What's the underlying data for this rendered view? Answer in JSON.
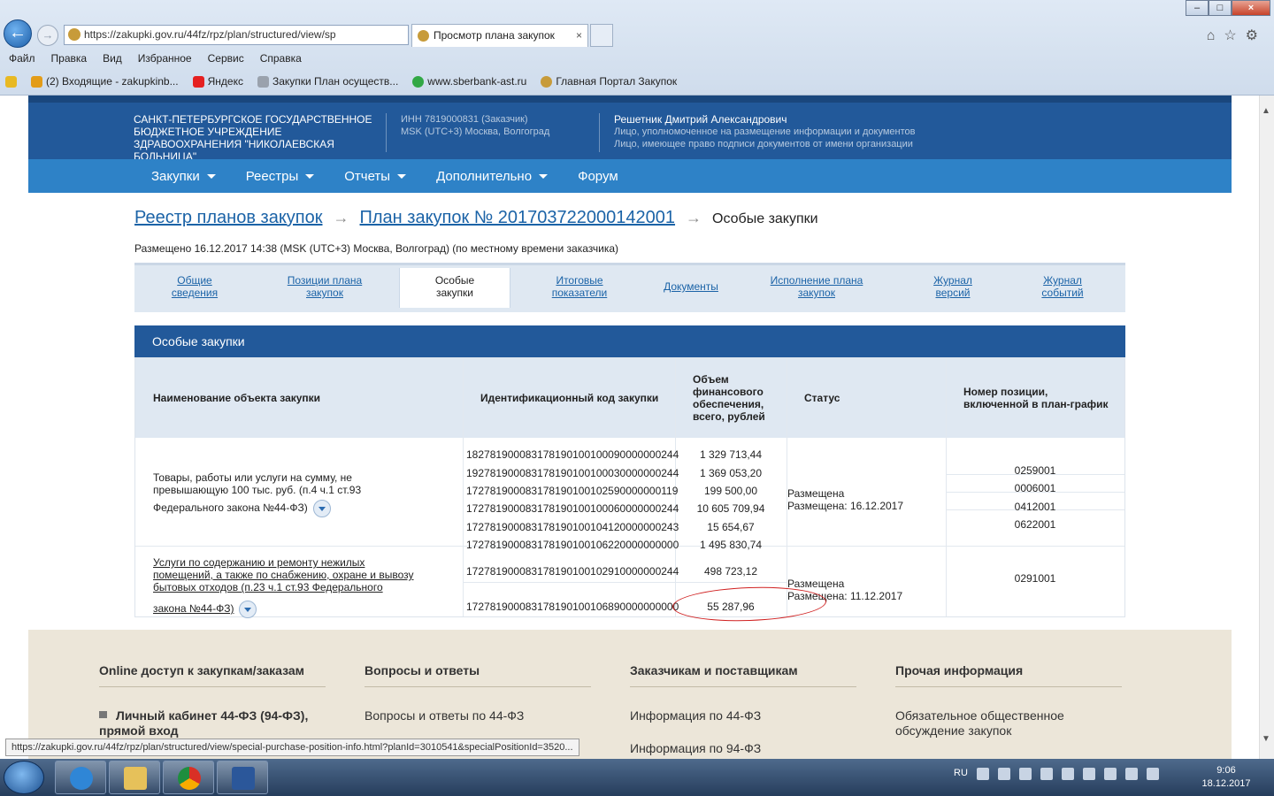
{
  "browser": {
    "url": "https://zakupki.gov.ru/44fz/rpz/plan/structured/view/sp",
    "tab_title": "Просмотр плана закупок",
    "menu": [
      "Файл",
      "Правка",
      "Вид",
      "Избранное",
      "Сервис",
      "Справка"
    ],
    "favorites": [
      "(2) Входящие - zakupkinb...",
      "Яндекс",
      "Закупки План осуществ...",
      "www.sberbank-ast.ru",
      "Главная Портал Закупок"
    ],
    "status_url": "https://zakupki.gov.ru/44fz/rpz/plan/structured/view/special-purchase-position-info.html?planId=3010541&specialPositionId=3520..."
  },
  "header": {
    "org_name": "САНКТ-ПЕТЕРБУРГСКОЕ ГОСУДАРСТВЕННОЕ БЮДЖЕТНОЕ УЧРЕЖДЕНИЕ ЗДРАВООХРАНЕНИЯ \"НИКОЛАЕВСКАЯ БОЛЬНИЦА\"",
    "inn": "ИНН 7819000831 (Заказчик)",
    "timezone": "MSK (UTC+3) Москва, Волгоград",
    "user_name": "Решетник Дмитрий Александрович",
    "user_role1": "Лицо, уполномоченное на размещение информации и документов",
    "user_role2": "Лицо, имеющее право подписи документов от имени организации"
  },
  "nav": [
    "Закупки",
    "Реестры",
    "Отчеты",
    "Дополнительно",
    "Форум"
  ],
  "breadcrumb": {
    "item1": "Реестр планов закупок",
    "item2": "План закупок № 201703722000142001",
    "current": "Особые закупки"
  },
  "posted": "Размещено 16.12.2017 14:38 (MSK (UTC+3) Москва, Волгоград) (по местному времени заказчика)",
  "tabs": [
    {
      "l1": "Общие",
      "l2": "сведения"
    },
    {
      "l1": "Позиции плана",
      "l2": "закупок"
    },
    {
      "l1": "Особые",
      "l2": "закупки"
    },
    {
      "l1": "Итоговые",
      "l2": "показатели"
    },
    {
      "l1": "Документы",
      "l2": ""
    },
    {
      "l1": "Исполнение плана",
      "l2": "закупок"
    },
    {
      "l1": "Журнал",
      "l2": "версий"
    },
    {
      "l1": "Журнал",
      "l2": "событий"
    }
  ],
  "panel_title": "Особые закупки",
  "table": {
    "headers": [
      "Наименование объекта закупки",
      "Идентификационный код закупки",
      "Объем финансового обеспечения, всего, рублей",
      "Статус",
      "Номер позиции, включенной в план-график"
    ],
    "group1": {
      "name1": "Товары, работы или услуги на сумму, не превышающую 100 тыс. руб. (п.4 ч.1 ст.93",
      "name2": "Федерального закона №44-ФЗ)",
      "codes": [
        "182781900083178190100100090000000244",
        "192781900083178190100100030000000244",
        "172781900083178190100102590000000119",
        "172781900083178190100100060000000244",
        "172781900083178190100104120000000243",
        "172781900083178190100106220000000000"
      ],
      "amounts": [
        "1 329 713,44",
        "1 369 053,20",
        "199 500,00",
        "10 605 709,94",
        "15 654,67",
        "1 495 830,74"
      ],
      "status": "Размещена",
      "status_date": "Размещена: 16.12.2017",
      "positions": [
        "0259001",
        "0006001",
        "0412001",
        "0622001"
      ]
    },
    "group2": {
      "name1": "Услуги по содержанию и ремонту нежилых помещений, а также по снабжению, охране и вывозу бытовых отходов (п.23 ч.1 ст.93 Федерального",
      "name2": "закона №44-ФЗ)",
      "codes": [
        "172781900083178190100102910000000244",
        "172781900083178190100106890000000000"
      ],
      "amounts": [
        "498 723,12",
        "55 287,96"
      ],
      "status": "Размещена",
      "status_date": "Размещена: 11.12.2017",
      "positions": [
        "0291001"
      ]
    }
  },
  "footer": {
    "cols": [
      {
        "title": "Online доступ к закупкам/заказам",
        "link": "Личный кабинет 44-ФЗ (94-ФЗ), прямой вход"
      },
      {
        "title": "Вопросы и ответы",
        "link": "Вопросы и ответы по 44-ФЗ"
      },
      {
        "title": "Заказчикам и поставщикам",
        "link": "Информация по 44-ФЗ",
        "link2": "Информация по 94-ФЗ"
      },
      {
        "title": "Прочая информация",
        "link": "Обязательное общественное обсуждение закупок"
      }
    ]
  },
  "taskbar": {
    "lang": "RU",
    "time": "9:06",
    "date": "18.12.2017"
  }
}
